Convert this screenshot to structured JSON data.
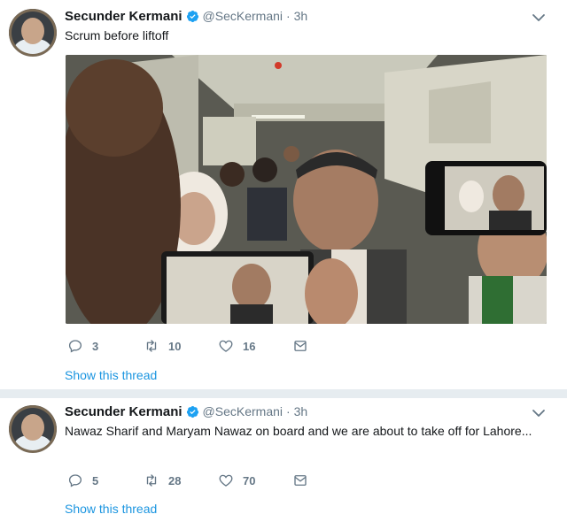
{
  "tweets": [
    {
      "author_name": "Secunder Kermani",
      "handle": "@SecKermani",
      "time": "· 3h",
      "text": "Scrum before liftoff",
      "replies": "3",
      "retweets": "10",
      "likes": "16",
      "thread_link": "Show this thread",
      "has_media": true
    },
    {
      "author_name": "Secunder Kermani",
      "handle": "@SecKermani",
      "time": "· 3h",
      "text": "Nawaz Sharif and Maryam Nawaz on board and we are about to take off for Lahore...",
      "replies": "5",
      "retweets": "28",
      "likes": "70",
      "thread_link": "Show this thread",
      "has_media": false
    }
  ],
  "icons": {
    "verified": "verified-badge-icon",
    "chevron": "chevron-down-icon",
    "reply": "reply-icon",
    "retweet": "retweet-icon",
    "like": "heart-icon",
    "dm": "envelope-icon"
  },
  "colors": {
    "link": "#1b95e0",
    "meta": "#657786",
    "separator": "#e6ecf0",
    "verified": "#1da1f2"
  }
}
